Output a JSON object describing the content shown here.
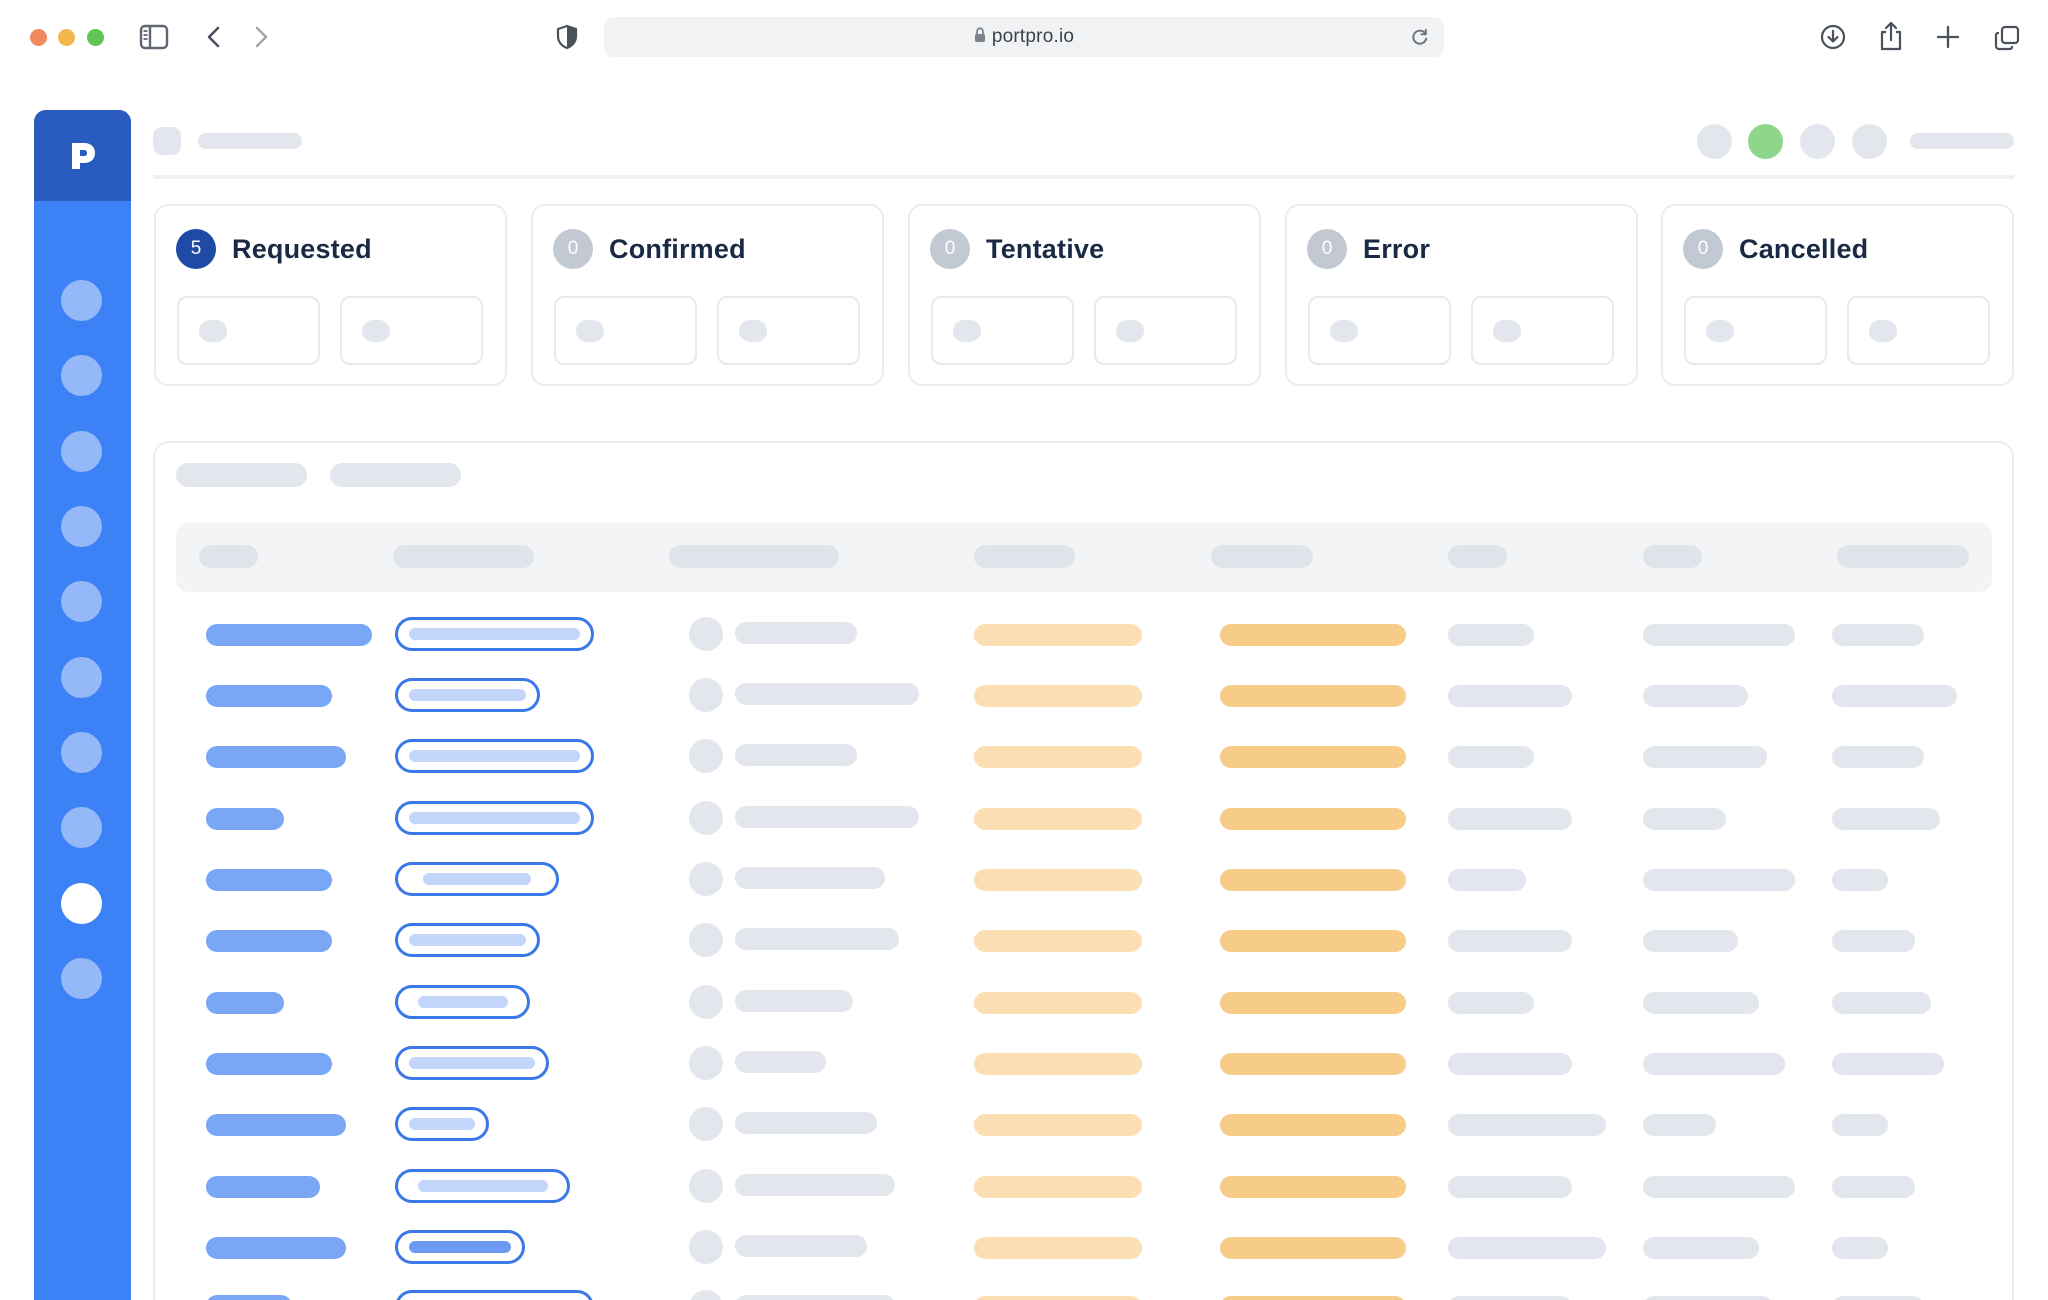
{
  "browser": {
    "url": "portpro.io",
    "icons": [
      "sidebar-toggle-icon",
      "back-icon",
      "forward-icon",
      "shield-icon",
      "lock-icon",
      "reload-icon",
      "download-icon",
      "share-icon",
      "new-tab-icon",
      "tabs-overview-icon"
    ]
  },
  "app": {
    "logo_icon": "portpro-logo-icon",
    "sidebar_item_count": 10,
    "sidebar_active_index": 8
  },
  "status_cards": [
    {
      "label": "Requested",
      "count": "5",
      "active": true
    },
    {
      "label": "Confirmed",
      "count": "0",
      "active": false
    },
    {
      "label": "Tentative",
      "count": "0",
      "active": false
    },
    {
      "label": "Error",
      "count": "0",
      "active": false
    },
    {
      "label": "Cancelled",
      "count": "0",
      "active": false
    }
  ],
  "colors": {
    "sidebar": "#3c82f6",
    "logo_bg": "#2a5bbf",
    "active_badge": "#1f4aa6",
    "online_status": "#8ed68b",
    "tag_border": "#3b78e7",
    "light_orange": "#fbdeb2",
    "orange": "#f7cb88"
  }
}
